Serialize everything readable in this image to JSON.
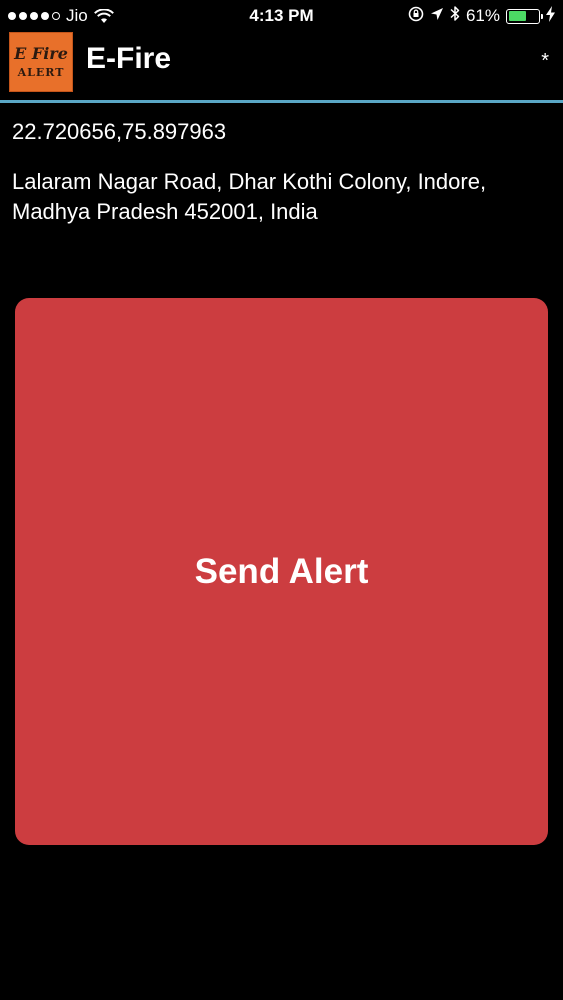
{
  "status_bar": {
    "carrier": "Jio",
    "time": "4:13 PM",
    "battery_percent": "61%",
    "battery_level": 0.61,
    "signal_bars_filled": 4,
    "signal_bars_total": 5,
    "battery_color": "#4cd964"
  },
  "app_bar": {
    "logo_line1": "E Fire",
    "logo_line2": "ALERT",
    "title": "E-Fire",
    "overflow": "*",
    "divider_color": "#5aa7c6"
  },
  "location": {
    "coordinates": "22.720656,75.897963",
    "address": "Lalaram Nagar Road, Dhar Kothi Colony, Indore, Madhya Pradesh 452001, India"
  },
  "actions": {
    "send_alert_label": "Send Alert",
    "send_alert_color": "#cc3d40"
  }
}
